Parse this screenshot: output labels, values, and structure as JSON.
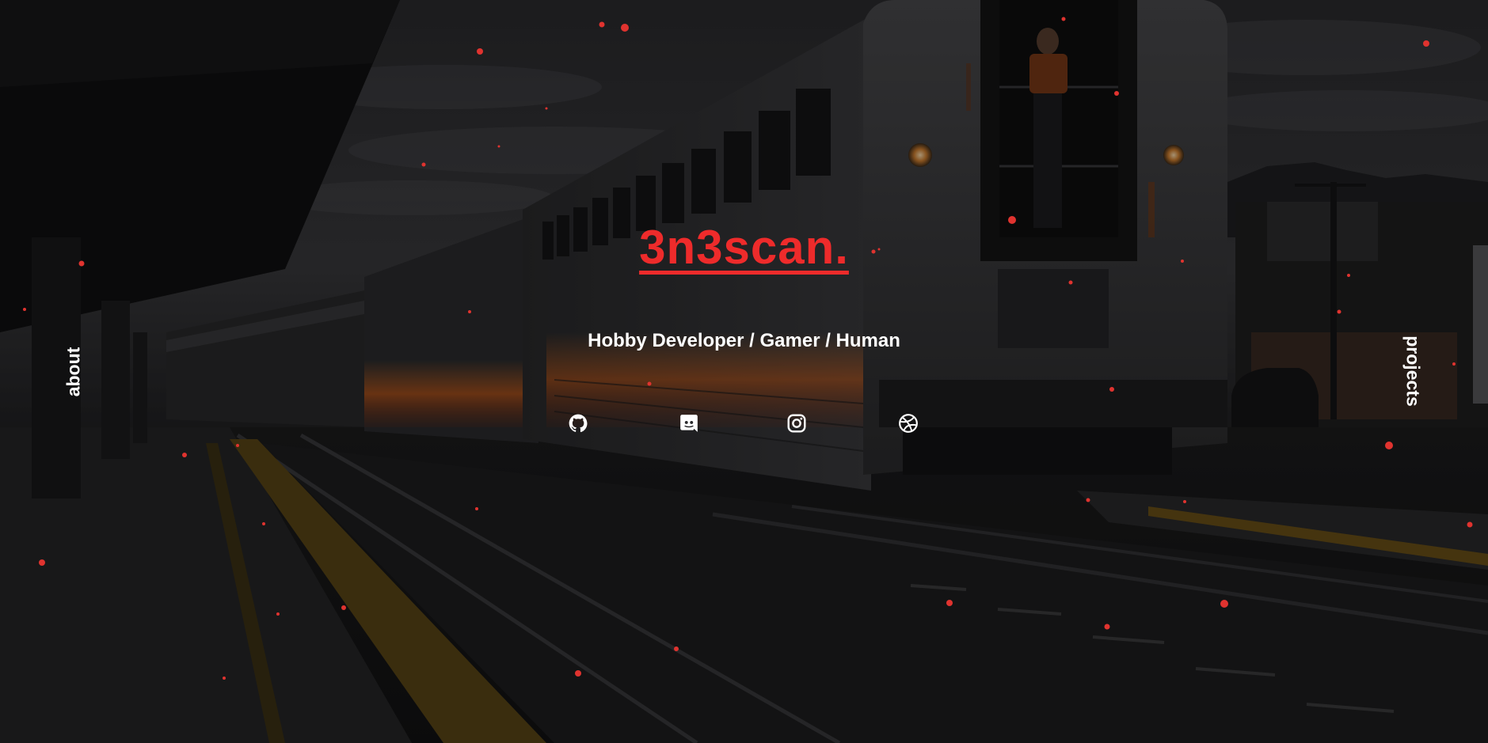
{
  "site": {
    "brand": "3n3scan.",
    "tagline": "Hobby Developer / Gamer / Human",
    "accent_color": "#ee2b2b"
  },
  "nav": {
    "left": "about",
    "right": "projects"
  },
  "social_links": [
    {
      "icon": "github-icon"
    },
    {
      "icon": "discord-icon"
    },
    {
      "icon": "instagram-icon"
    },
    {
      "icon": "dribbble-icon"
    }
  ],
  "background": {
    "scene": "train-station-at-dusk"
  }
}
